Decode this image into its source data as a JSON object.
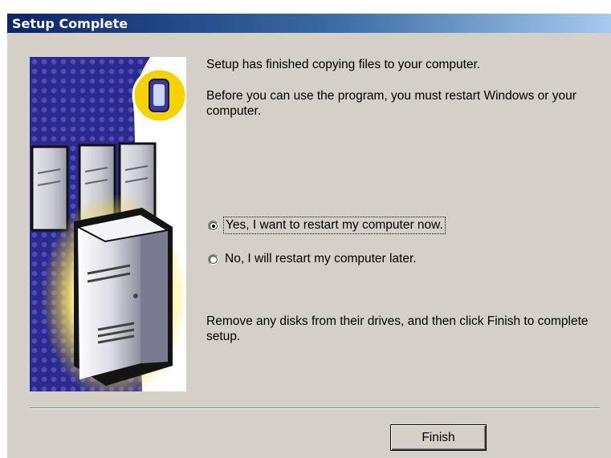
{
  "window": {
    "title": "Setup Complete"
  },
  "side_image": {
    "description_icon": "computer-servers-illustration"
  },
  "messages": {
    "line1": "Setup has finished copying files to your computer.",
    "line2": "Before you can use the program, you must restart Windows or your computer.",
    "line3": "Remove any disks from their drives, and then click Finish to complete setup."
  },
  "restart_options": [
    {
      "label": "Yes, I want to restart my computer now.",
      "selected": true
    },
    {
      "label": "No, I will restart my computer later.",
      "selected": false
    }
  ],
  "buttons": {
    "finish_label": "Finish"
  },
  "colors": {
    "dialog_bg": "#d4d0c8",
    "title_start": "#0a246a",
    "title_end": "#a6caf0",
    "art_blue": "#2c2a8f",
    "art_yellow": "#f5d300"
  }
}
